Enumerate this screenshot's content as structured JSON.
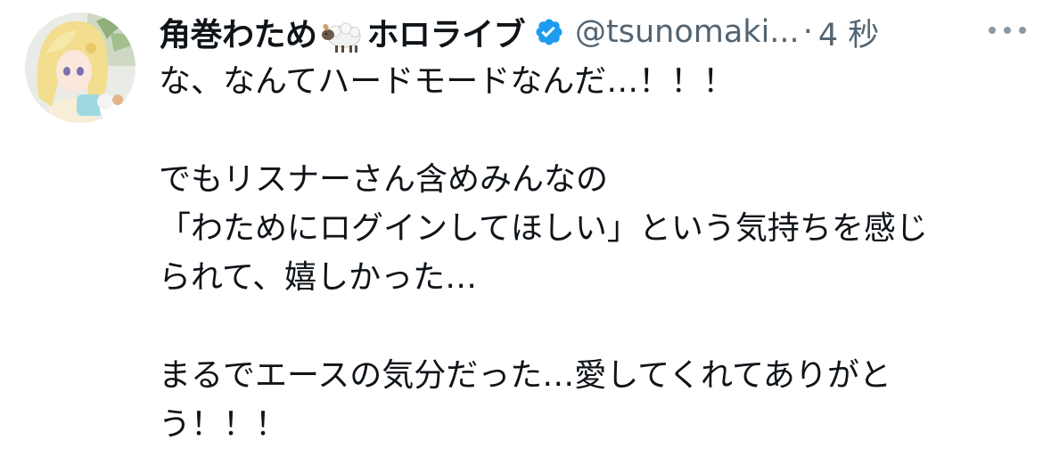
{
  "tweet": {
    "display_name_part1": "角巻わため",
    "display_name_emoji": "sheep-emoji",
    "display_name_part2": "ホロライブ",
    "verified_icon": "verified-badge-icon",
    "handle": "@tsunomaki...",
    "separator": "·",
    "time": "4 秒",
    "more_icon": "more-options-icon",
    "avatar": "avatar",
    "body": {
      "line1": "な、なんてハードモードなんだ…！！！",
      "line2": "でもリスナーさん含めみんなの",
      "line3": "「わためにログインしてほしい」という気持ちを感じ",
      "line4": "られて、嬉しかった…",
      "line5": "まるでエースの気分だった…愛してくれてありがと",
      "line6": "う！！！"
    }
  },
  "colors": {
    "text_primary": "#0f1419",
    "text_secondary": "#536471",
    "verified": "#1d9bf0",
    "background": "#ffffff"
  }
}
